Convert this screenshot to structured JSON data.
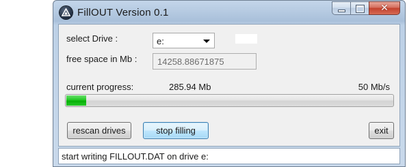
{
  "window": {
    "title": "FillOUT Version 0.1"
  },
  "form": {
    "select_drive_label": "select Drive :",
    "drive_selected": "e:",
    "free_space_label": "free space in Mb :",
    "free_space_value": "14258.88671875",
    "current_progress_label": "current progress:",
    "written_amount": "285.94 Mb",
    "speed": "50 Mb/s",
    "progress_fraction": 0.06
  },
  "buttons": {
    "rescan": "rescan drives",
    "stop": "stop filling",
    "exit": "exit"
  },
  "status": {
    "text": "start writing FILLOUT.DAT on drive e:"
  },
  "colors": {
    "progress_fill": "#06b006",
    "close_button": "#c3422e"
  }
}
